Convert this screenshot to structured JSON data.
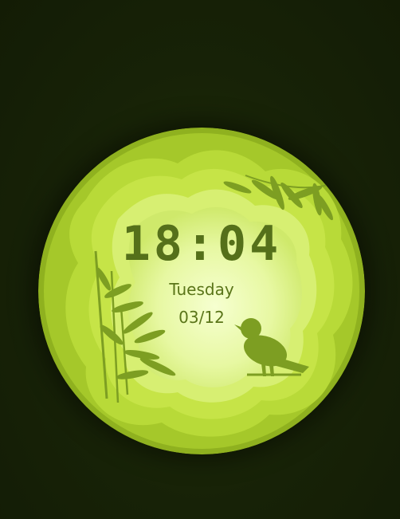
{
  "watch": {
    "time": "18:04",
    "day": "Tuesday",
    "date": "03/12"
  },
  "colors": {
    "background": "#192407",
    "accent_light": "#e9f8a8",
    "accent_mid": "#b7d936",
    "accent_dark": "#55701a"
  },
  "icons": [
    "bamboo-icon",
    "bird-icon"
  ]
}
